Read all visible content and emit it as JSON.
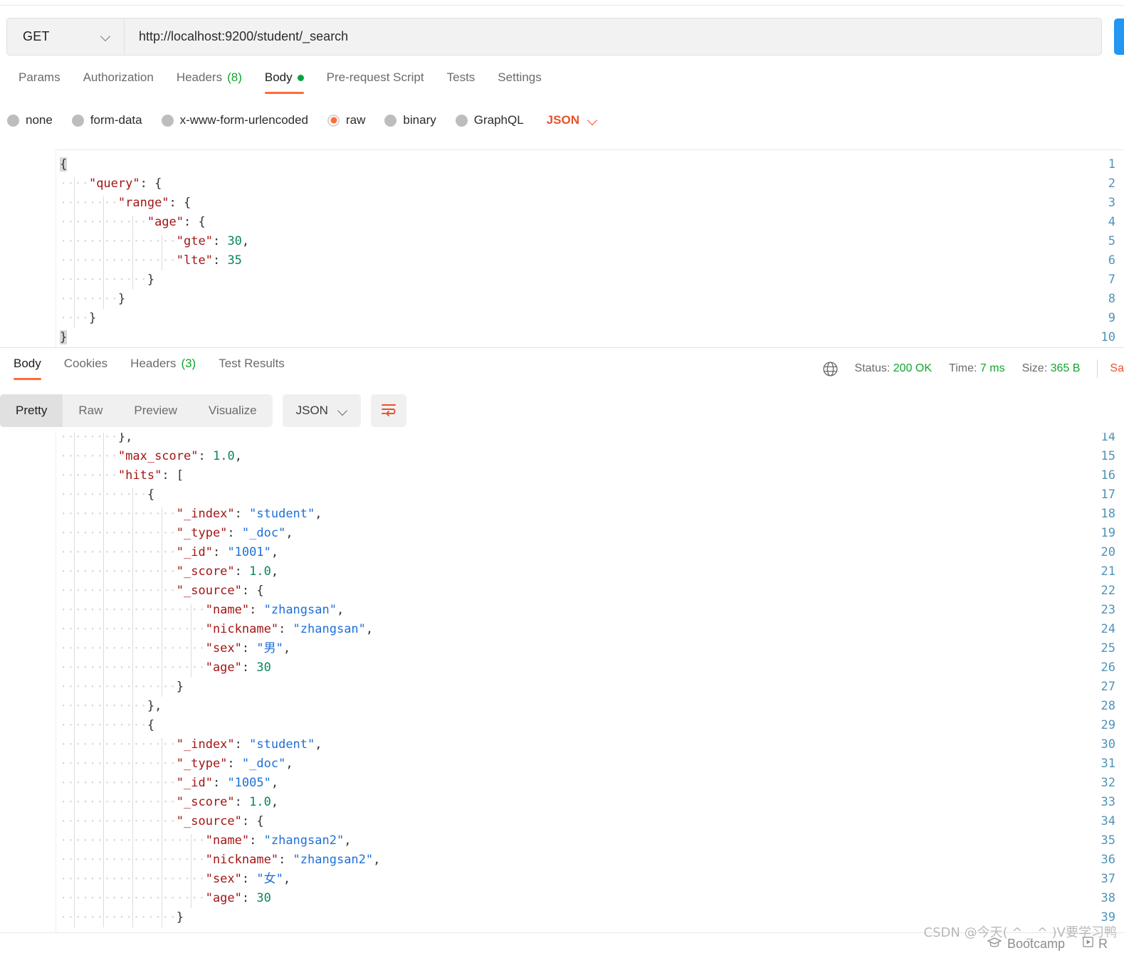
{
  "request": {
    "method": "GET",
    "method_icon": "chevron-down-icon",
    "url": "http://localhost:9200/student/_search",
    "send_label": "",
    "tabs": [
      {
        "label": "Params",
        "active": false,
        "count": ""
      },
      {
        "label": "Authorization",
        "active": false,
        "count": ""
      },
      {
        "label": "Headers",
        "active": false,
        "count": "(8)"
      },
      {
        "label": "Body",
        "active": true,
        "count": ""
      },
      {
        "label": "Pre-request Script",
        "active": false,
        "count": ""
      },
      {
        "label": "Tests",
        "active": false,
        "count": ""
      },
      {
        "label": "Settings",
        "active": false,
        "count": ""
      }
    ],
    "body_types": [
      {
        "label": "none",
        "selected": false
      },
      {
        "label": "form-data",
        "selected": false
      },
      {
        "label": "x-www-form-urlencoded",
        "selected": false
      },
      {
        "label": "raw",
        "selected": true
      },
      {
        "label": "binary",
        "selected": false
      },
      {
        "label": "GraphQL",
        "selected": false
      }
    ],
    "raw_format": "JSON",
    "raw_format_icon": "chevron-down-icon",
    "code_lines": [
      {
        "no": "1",
        "indent": 0,
        "text": "{",
        "brace_hl": true
      },
      {
        "no": "2",
        "indent": 1,
        "text": "\"query\": {"
      },
      {
        "no": "3",
        "indent": 2,
        "text": "\"range\": {"
      },
      {
        "no": "4",
        "indent": 3,
        "text": "\"age\": {"
      },
      {
        "no": "5",
        "indent": 4,
        "text": "\"gte\": 30,"
      },
      {
        "no": "6",
        "indent": 4,
        "text": "\"lte\": 35"
      },
      {
        "no": "7",
        "indent": 3,
        "text": "}"
      },
      {
        "no": "8",
        "indent": 2,
        "text": "}"
      },
      {
        "no": "9",
        "indent": 1,
        "text": "}"
      },
      {
        "no": "10",
        "indent": 0,
        "text": "}",
        "brace_hl": true
      }
    ]
  },
  "response": {
    "tabs": [
      {
        "label": "Body",
        "active": true,
        "count": ""
      },
      {
        "label": "Cookies",
        "active": false,
        "count": ""
      },
      {
        "label": "Headers",
        "active": false,
        "count": "(3)"
      },
      {
        "label": "Test Results",
        "active": false,
        "count": ""
      }
    ],
    "meta": {
      "globe_icon": "globe-icon",
      "status_label": "Status:",
      "status_value": "200 OK",
      "time_label": "Time:",
      "time_value": "7 ms",
      "size_label": "Size:",
      "size_value": "365 B",
      "save_response": "Sa"
    },
    "view_modes": [
      {
        "label": "Pretty",
        "active": true
      },
      {
        "label": "Raw",
        "active": false
      },
      {
        "label": "Preview",
        "active": false
      },
      {
        "label": "Visualize",
        "active": false
      }
    ],
    "format": "JSON",
    "format_icon": "chevron-down-icon",
    "wrap_icon": "word-wrap-icon",
    "code_lines": [
      {
        "no": "14",
        "indent": 2,
        "text": "},",
        "clipped": true
      },
      {
        "no": "15",
        "indent": 2,
        "text": "\"max_score\": 1.0,"
      },
      {
        "no": "16",
        "indent": 2,
        "text": "\"hits\": ["
      },
      {
        "no": "17",
        "indent": 3,
        "text": "{"
      },
      {
        "no": "18",
        "indent": 4,
        "text": "\"_index\": \"student\","
      },
      {
        "no": "19",
        "indent": 4,
        "text": "\"_type\": \"_doc\","
      },
      {
        "no": "20",
        "indent": 4,
        "text": "\"_id\": \"1001\","
      },
      {
        "no": "21",
        "indent": 4,
        "text": "\"_score\": 1.0,"
      },
      {
        "no": "22",
        "indent": 4,
        "text": "\"_source\": {"
      },
      {
        "no": "23",
        "indent": 5,
        "text": "\"name\": \"zhangsan\","
      },
      {
        "no": "24",
        "indent": 5,
        "text": "\"nickname\": \"zhangsan\","
      },
      {
        "no": "25",
        "indent": 5,
        "text": "\"sex\": \"男\","
      },
      {
        "no": "26",
        "indent": 5,
        "text": "\"age\": 30"
      },
      {
        "no": "27",
        "indent": 4,
        "text": "}"
      },
      {
        "no": "28",
        "indent": 3,
        "text": "},"
      },
      {
        "no": "29",
        "indent": 3,
        "text": "{"
      },
      {
        "no": "30",
        "indent": 4,
        "text": "\"_index\": \"student\","
      },
      {
        "no": "31",
        "indent": 4,
        "text": "\"_type\": \"_doc\","
      },
      {
        "no": "32",
        "indent": 4,
        "text": "\"_id\": \"1005\","
      },
      {
        "no": "33",
        "indent": 4,
        "text": "\"_score\": 1.0,"
      },
      {
        "no": "34",
        "indent": 4,
        "text": "\"_source\": {"
      },
      {
        "no": "35",
        "indent": 5,
        "text": "\"name\": \"zhangsan2\","
      },
      {
        "no": "36",
        "indent": 5,
        "text": "\"nickname\": \"zhangsan2\","
      },
      {
        "no": "37",
        "indent": 5,
        "text": "\"sex\": \"女\","
      },
      {
        "no": "38",
        "indent": 5,
        "text": "\"age\": 30"
      },
      {
        "no": "39",
        "indent": 4,
        "text": "}"
      }
    ]
  },
  "footer": {
    "watermark": "CSDN @今天( ^ _ ^ )V要学习鸭",
    "bootcamp_label": "Bootcamp",
    "bootcamp_icon": "graduation-cap-icon",
    "runner_label": "R",
    "runner_icon": "play-box-icon"
  }
}
